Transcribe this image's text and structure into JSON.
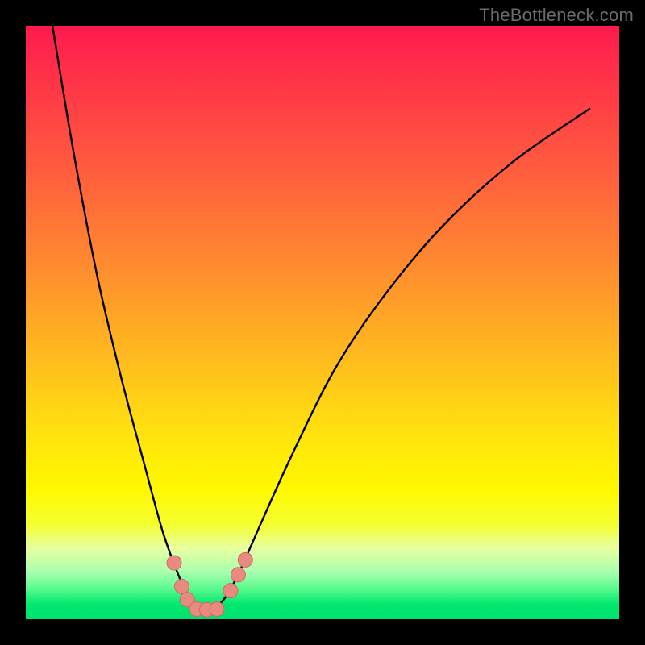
{
  "watermark": "TheBottleneck.com",
  "chart_data": {
    "type": "line",
    "title": "",
    "xlabel": "",
    "ylabel": "",
    "xlim": [
      0,
      100
    ],
    "ylim": [
      0,
      100
    ],
    "series": [
      {
        "name": "curve",
        "x": [
          4.5,
          8,
          12,
          16,
          20,
          23,
          25.5,
          27.5,
          28.8,
          30,
          31.5,
          33.5,
          36,
          40,
          45,
          52,
          60,
          70,
          82,
          95
        ],
        "y": [
          100,
          79,
          58,
          41,
          26,
          15,
          8,
          3.5,
          1.8,
          1.5,
          1.8,
          3.5,
          8,
          17,
          28,
          42,
          54,
          66,
          77,
          86
        ]
      }
    ],
    "markers": [
      {
        "x": 25.0,
        "y": 9.5
      },
      {
        "x": 26.3,
        "y": 5.5
      },
      {
        "x": 27.2,
        "y": 3.3
      },
      {
        "x": 28.8,
        "y": 1.7
      },
      {
        "x": 30.5,
        "y": 1.6
      },
      {
        "x": 32.2,
        "y": 1.7
      },
      {
        "x": 34.5,
        "y": 4.8
      },
      {
        "x": 35.8,
        "y": 7.5
      },
      {
        "x": 37.0,
        "y": 10.0
      }
    ],
    "colors": {
      "curve": "#000000",
      "marker_fill": "#e88a80",
      "marker_stroke": "#d06a60"
    }
  }
}
